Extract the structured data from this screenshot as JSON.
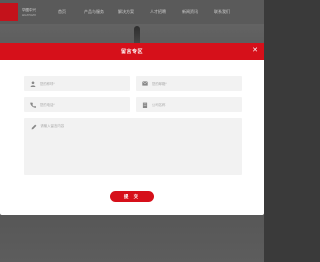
{
  "site": {
    "logo_line1": "华图中兴",
    "logo_line2": "HUATUZX",
    "nav": [
      "首页",
      "产品与服务",
      "解决方案",
      "人才招聘",
      "新闻资讯",
      "联系我们"
    ]
  },
  "modal": {
    "title": "留言专区",
    "fields": {
      "name_placeholder": "您的称呼*",
      "email_placeholder": "您的邮箱*",
      "phone_placeholder": "您的电话*",
      "company_placeholder": "公司名称",
      "message_placeholder": "请输入留言内容"
    },
    "submit_label": "提 交"
  },
  "colors": {
    "accent": "#d6101a",
    "field_bg": "#f2f2f2"
  },
  "icons": {
    "close": "close-icon",
    "name": "user-icon",
    "email": "mail-icon",
    "phone": "phone-icon",
    "company": "building-icon",
    "message": "pencil-icon"
  }
}
